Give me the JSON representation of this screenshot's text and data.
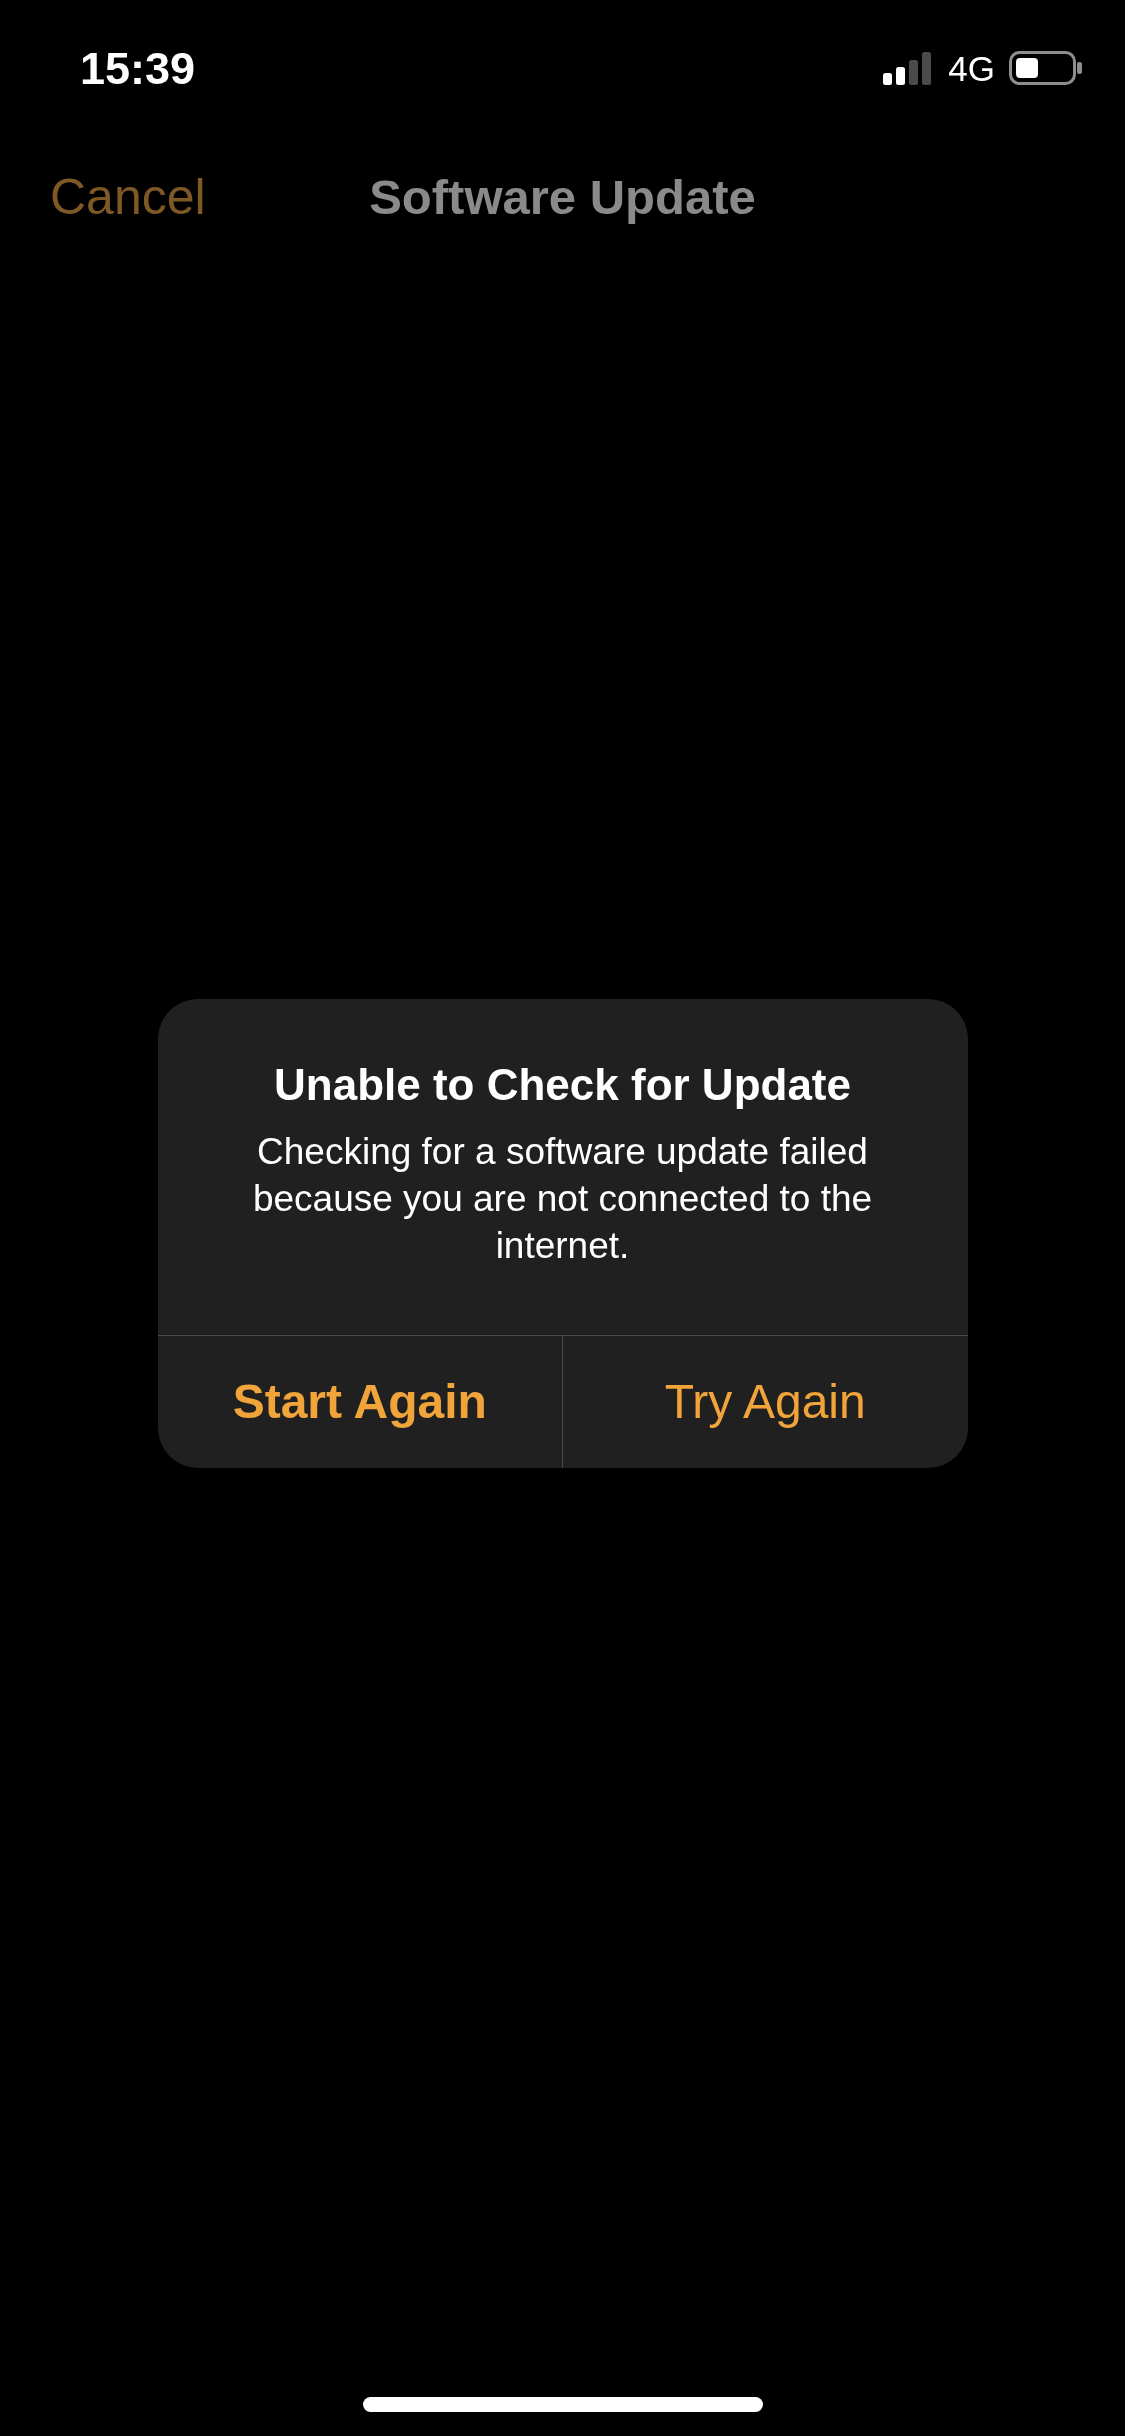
{
  "status_bar": {
    "time": "15:39",
    "network": "4G"
  },
  "nav_bar": {
    "cancel": "Cancel",
    "title": "Software Update"
  },
  "alert": {
    "title": "Unable to Check for Update",
    "message": "Checking for a software update failed because you are not connected to the internet.",
    "buttons": [
      {
        "label": "Start Again",
        "kind": "preferred"
      },
      {
        "label": "Try Again",
        "kind": "default"
      }
    ]
  }
}
